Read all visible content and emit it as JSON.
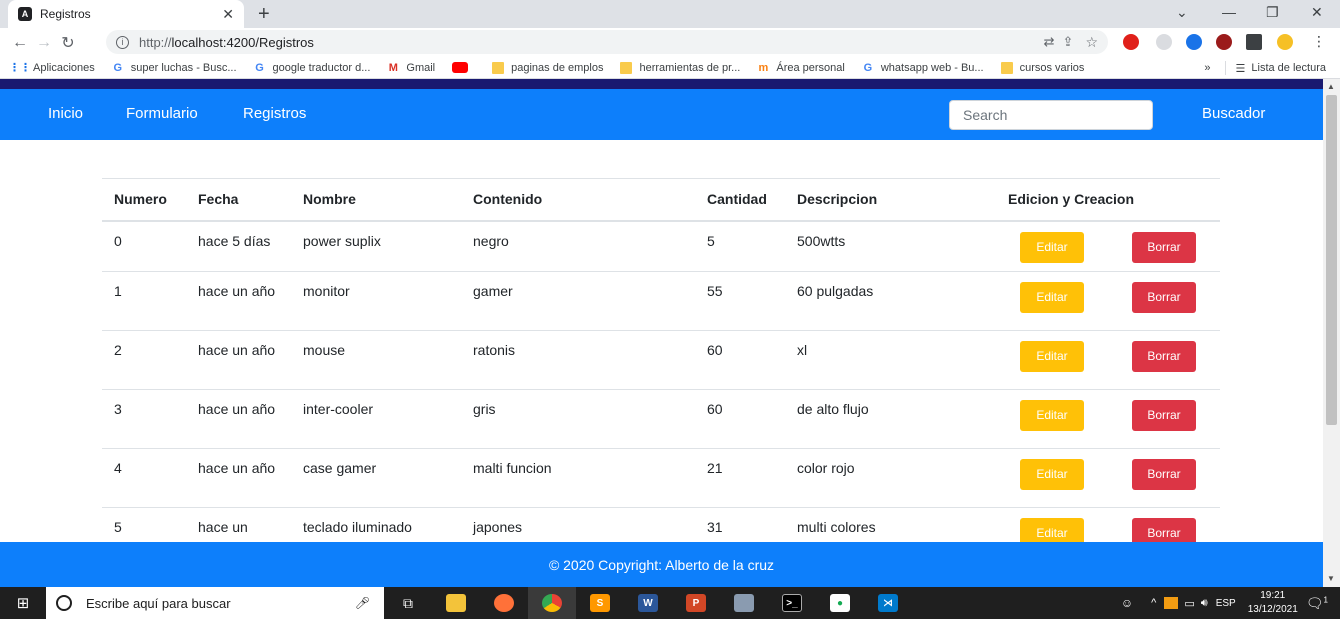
{
  "browser": {
    "tab_title": "Registros",
    "tab_favicon": "A",
    "url_protocol": "http://",
    "url_rest": "localhost:4200/Registros",
    "bookmarks": [
      {
        "label": "Aplicaciones",
        "icon": "apps-grid-icon"
      },
      {
        "label": "super luchas - Busc...",
        "icon": "google-icon"
      },
      {
        "label": "google traductor d...",
        "icon": "google-icon"
      },
      {
        "label": "Gmail",
        "icon": "gmail-icon"
      },
      {
        "label": "",
        "icon": "youtube-icon"
      },
      {
        "label": "paginas de emplos",
        "icon": "folder-icon"
      },
      {
        "label": "herramientas de pr...",
        "icon": "folder-icon"
      },
      {
        "label": "Área personal",
        "icon": "moodle-icon"
      },
      {
        "label": "whatsapp web - Bu...",
        "icon": "google-icon"
      },
      {
        "label": "cursos varios",
        "icon": "folder-icon"
      }
    ],
    "bookmarks_more": "»",
    "reading_list": "Lista de lectura"
  },
  "navbar": {
    "links": [
      "Inicio",
      "Formulario",
      "Registros"
    ],
    "search_placeholder": "Search",
    "search_button": "Buscador"
  },
  "table": {
    "headers": [
      "Numero",
      "Fecha",
      "Nombre",
      "Contenido",
      "Cantidad",
      "Descripcion",
      "Edicion y Creacion"
    ],
    "edit_label": "Editar",
    "delete_label": "Borrar",
    "rows": [
      {
        "numero": "0",
        "fecha": "hace 5 días",
        "nombre": "power suplix",
        "contenido": "negro",
        "cantidad": "5",
        "descripcion": "500wtts"
      },
      {
        "numero": "1",
        "fecha": "hace un año",
        "nombre": "monitor",
        "contenido": "gamer",
        "cantidad": "55",
        "descripcion": "60 pulgadas"
      },
      {
        "numero": "2",
        "fecha": "hace un año",
        "nombre": "mouse",
        "contenido": "ratonis",
        "cantidad": "60",
        "descripcion": "xl"
      },
      {
        "numero": "3",
        "fecha": "hace un año",
        "nombre": "inter-cooler",
        "contenido": "gris",
        "cantidad": "60",
        "descripcion": "de alto flujo"
      },
      {
        "numero": "4",
        "fecha": "hace un año",
        "nombre": "case gamer",
        "contenido": "malti funcion",
        "cantidad": "21",
        "descripcion": "color rojo"
      },
      {
        "numero": "5",
        "fecha": "hace un",
        "nombre": "teclado iluminado",
        "contenido": "japones",
        "cantidad": "31",
        "descripcion": "multi colores"
      }
    ]
  },
  "footer": {
    "text": "© 2020 Copyright: Alberto de la cruz"
  },
  "taskbar": {
    "search_placeholder": "Escribe aquí para buscar",
    "language": "ESP",
    "time": "19:21",
    "date": "13/12/2021",
    "notification_count": "1"
  },
  "colors": {
    "navbar": "#0d7ffb",
    "stripe": "#191970",
    "edit_button": "#ffc107",
    "delete_button": "#dc3545"
  }
}
